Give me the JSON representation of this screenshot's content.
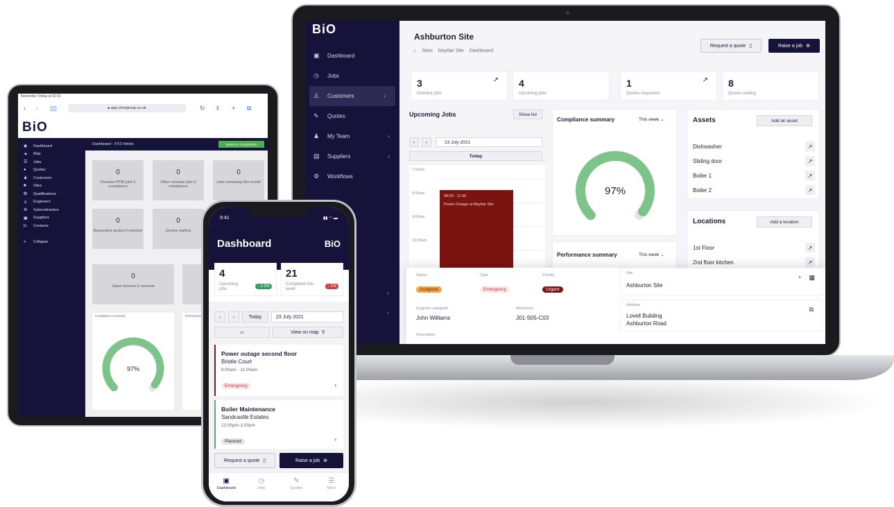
{
  "laptop": {
    "logo": "BiO",
    "nav": [
      {
        "label": "Dashboard",
        "icon": "dashboard-icon",
        "glyph": "▣"
      },
      {
        "label": "Jobs",
        "icon": "clock-icon",
        "glyph": "◷"
      },
      {
        "label": "Customers",
        "icon": "user-icon",
        "glyph": "♙"
      },
      {
        "label": "Quotes",
        "icon": "pen-icon",
        "glyph": "✎"
      },
      {
        "label": "My Team",
        "icon": "team-icon",
        "glyph": "♟"
      },
      {
        "label": "Suppliers",
        "icon": "store-icon",
        "glyph": "▤"
      },
      {
        "label": "Workflows",
        "icon": "workflow-icon",
        "glyph": "⚙"
      }
    ],
    "title": "Ashburton Site",
    "breadcrumb": [
      "Sites",
      "Mayfair Site",
      "Dashboard"
    ],
    "request_quote": "Request a quote",
    "raise_job": "Raise a job",
    "stats": [
      {
        "value": "3",
        "label": "Overdue jobs"
      },
      {
        "value": "4",
        "label": "Upcoming jobs"
      },
      {
        "value": "1",
        "label": "Quotes requested"
      },
      {
        "value": "8",
        "label": "Quotes waiting"
      }
    ],
    "upcoming": {
      "title": "Upcoming Jobs",
      "show_list": "Show list",
      "date": "23 July 2021",
      "today": "Today",
      "slots": [
        "7:00am",
        "8:00am",
        "9:00am",
        "10:00am"
      ],
      "event_time": "08:00 - 11:00",
      "event_title": "Power Outage at Mayfair Site"
    },
    "compliance": {
      "title": "Compliance summary",
      "period": "This week",
      "value": "97%",
      "fraction": 0.97
    },
    "performance": {
      "title": "Performance summary",
      "period": "This week"
    },
    "assets": {
      "title": "Assets",
      "add": "Add an asset",
      "items": [
        "Dishwasher",
        "Sliding door",
        "Boiler 1",
        "Boiler 2"
      ]
    },
    "locations": {
      "title": "Locations",
      "add": "Add a location",
      "items": [
        "1st Floor",
        "2nd floor kitchen"
      ]
    },
    "detail": {
      "status_label": "Status",
      "status": "Assigned",
      "type_label": "Type",
      "type": "Emergency",
      "priority_label": "Priority",
      "priority": "Urgent",
      "engineer_label": "Engineer assigned",
      "engineer": "John Williams",
      "reference_label": "Reference",
      "reference": "J01-S05-C03",
      "description_label": "Description",
      "site_label": "Site",
      "site": "Ashburton Site",
      "address_label": "Address",
      "address1": "Lovell Building",
      "address2": "Ashburton Road"
    }
  },
  "tablet": {
    "status": "November Friday at 10:15",
    "url": "app.chimgroup.co.uk",
    "logo": "BiO",
    "nav": [
      "Dashboard",
      "Map",
      "Jobs",
      "Quotes",
      "Customers",
      "Sites",
      "Qualifications",
      "Engineers",
      "Subcontractors",
      "Suppliers",
      "Contacts"
    ],
    "collapse": "Collapse",
    "header": "Dashboard - XYZ Hotels",
    "header_btn": "DISPLAY CALENDAR",
    "cards": [
      {
        "value": "0",
        "label": "Overdue PPM jobs 0 compliance"
      },
      {
        "value": "0",
        "label": "Other overdue jobs 0 compliance"
      },
      {
        "value": "0",
        "label": "Jobs remaining this month"
      },
      {
        "value": "0",
        "label": "Requested quotes 0 overdue"
      },
      {
        "value": "0",
        "label": "Quotes waiting"
      },
      {
        "value": "0",
        "label": "Sales invoices 0 overdue"
      }
    ],
    "compliance_title": "Compliance summary",
    "performance_title": "Performance",
    "gauge_value": "97%",
    "gauge_fraction": 0.97
  },
  "phone": {
    "time": "9:41",
    "title": "Dashboard",
    "logo": "BiO",
    "stats": [
      {
        "value": "4",
        "label": "Upcoming jobs",
        "badge": "↑ 2.5%",
        "badge_color": "#2e9c5a"
      },
      {
        "value": "21",
        "label": "Completed this week",
        "badge": "↓ 1%",
        "badge_color": "#d33b3b"
      }
    ],
    "today": "Today",
    "date": "23 July 2021",
    "view_map": "View on map",
    "jobs": [
      {
        "title": "Power outage second floor",
        "site": "Bristle Court",
        "hours": "8:00am - 11:00am",
        "tag": "Emergency",
        "accent": "#7b1a1a"
      },
      {
        "title": "Boiler Maintenance",
        "site": "Sandcastle Estates",
        "hours": "12:00pm-1:00pm",
        "tag": "Planned",
        "accent": "#5aa877"
      }
    ],
    "request_quote": "Request a quote",
    "raise_job": "Raise a job",
    "tabs": [
      {
        "label": "Dashboard",
        "glyph": "▣"
      },
      {
        "label": "Jobs",
        "glyph": "◷"
      },
      {
        "label": "Quotes",
        "glyph": "✎"
      },
      {
        "label": "More",
        "glyph": "☰"
      }
    ]
  }
}
